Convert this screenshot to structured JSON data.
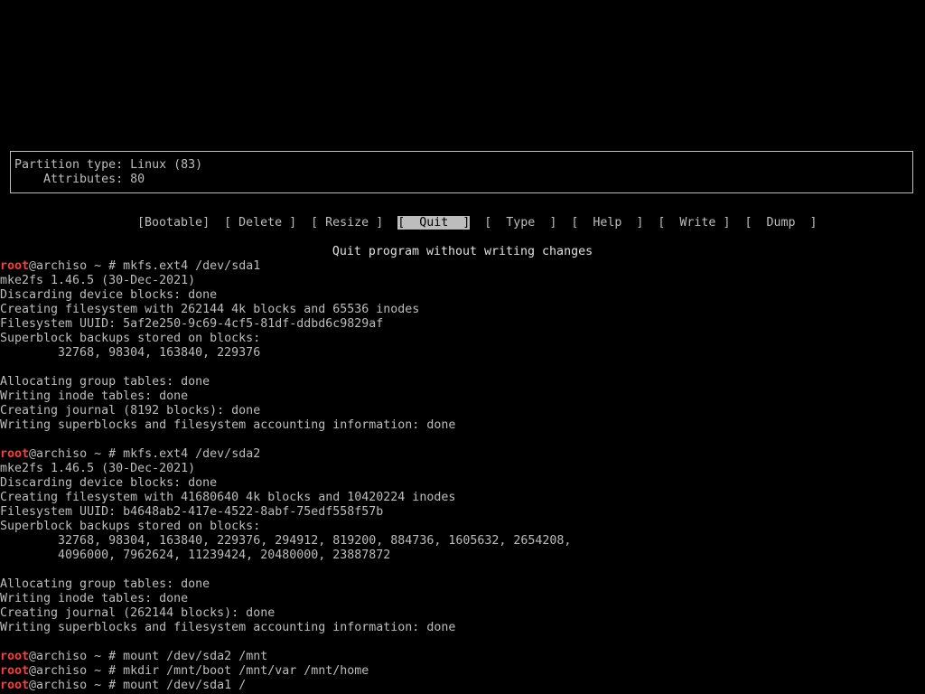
{
  "info": {
    "line1": "Partition type: Linux (83)",
    "line2": "    Attributes: 80"
  },
  "menu": {
    "items": [
      {
        "label": "[Bootable]",
        "selected": false
      },
      {
        "label": "[ Delete ]",
        "selected": false
      },
      {
        "label": "[ Resize ]",
        "selected": false
      },
      {
        "label": "[  Quit  ]",
        "selected": true
      },
      {
        "label": "[  Type  ]",
        "selected": false
      },
      {
        "label": "[  Help  ]",
        "selected": false
      },
      {
        "label": "[  Write ]",
        "selected": false
      },
      {
        "label": "[  Dump  ]",
        "selected": false
      }
    ]
  },
  "status_text": "Quit program without writing changes",
  "prompt": {
    "user": "root",
    "host": "@archiso ~ # "
  },
  "terminal": {
    "l01": "mkfs.ext4 /dev/sda1",
    "l02": "mke2fs 1.46.5 (30-Dec-2021)",
    "l03": "Discarding device blocks: done",
    "l04": "Creating filesystem with 262144 4k blocks and 65536 inodes",
    "l05": "Filesystem UUID: 5af2e250-9c69-4cf5-81df-ddbd6c9829af",
    "l06": "Superblock backups stored on blocks:",
    "l07": "        32768, 98304, 163840, 229376",
    "l09": "Allocating group tables: done",
    "l10": "Writing inode tables: done",
    "l11": "Creating journal (8192 blocks): done",
    "l12": "Writing superblocks and filesystem accounting information: done",
    "l14": "mkfs.ext4 /dev/sda2",
    "l15": "mke2fs 1.46.5 (30-Dec-2021)",
    "l16": "Discarding device blocks: done",
    "l17": "Creating filesystem with 41680640 4k blocks and 10420224 inodes",
    "l18": "Filesystem UUID: b4648ab2-417e-4522-8abf-75edf558f57b",
    "l19": "Superblock backups stored on blocks:",
    "l20": "        32768, 98304, 163840, 229376, 294912, 819200, 884736, 1605632, 2654208,",
    "l21": "        4096000, 7962624, 11239424, 20480000, 23887872",
    "l23": "Allocating group tables: done",
    "l24": "Writing inode tables: done",
    "l25": "Creating journal (262144 blocks): done",
    "l26": "Writing superblocks and filesystem accounting information: done",
    "l28": "mount /dev/sda2 /mnt",
    "l29": "mkdir /mnt/boot /mnt/var /mnt/home",
    "l30": "mount /dev/sda1 /"
  }
}
